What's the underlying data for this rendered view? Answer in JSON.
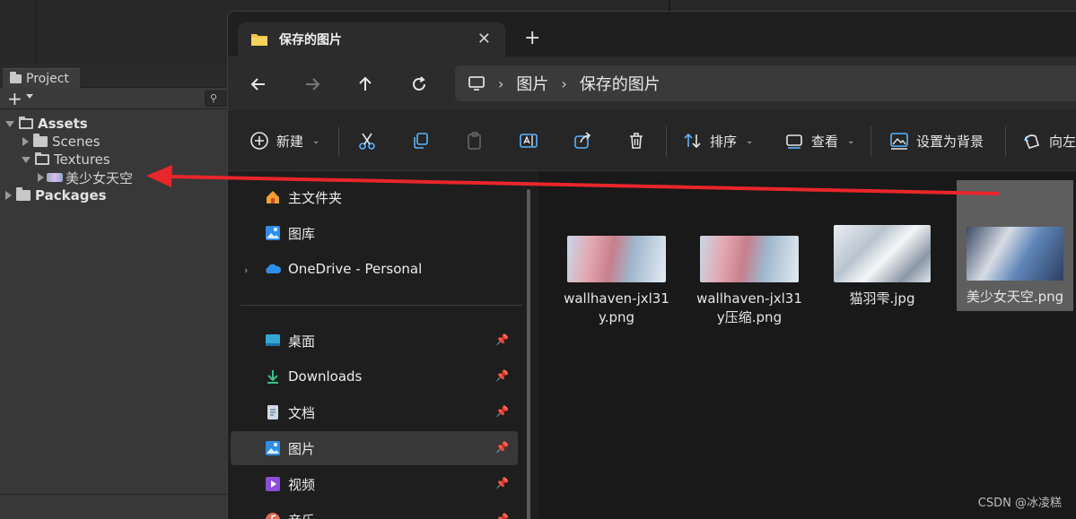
{
  "unity": {
    "panel_tab": "Project",
    "search_hint": "q",
    "tree": {
      "assets": "Assets",
      "scenes": "Scenes",
      "textures": "Textures",
      "image_asset": "美少女天空",
      "packages": "Packages"
    }
  },
  "explorer": {
    "tab_title": "保存的图片",
    "breadcrumb": [
      "图片",
      "保存的图片"
    ],
    "commands": {
      "new": "新建",
      "sort": "排序",
      "view": "查看",
      "set_background": "设置为背景",
      "rotate_left": "向左"
    },
    "nav": {
      "home": "主文件夹",
      "gallery": "图库",
      "onedrive": "OneDrive - Personal",
      "desktop": "桌面",
      "downloads": "Downloads",
      "documents": "文档",
      "pictures": "图片",
      "videos": "视频",
      "music": "音乐"
    },
    "files": [
      {
        "name_line1": "wallhaven-jxl31",
        "name_line2": "y.png"
      },
      {
        "name_line1": "wallhaven-jxl31",
        "name_line2": "y压缩.png"
      },
      {
        "name_line1": "猫羽雫.jpg",
        "name_line2": ""
      },
      {
        "name_line1": "美少女天空.png",
        "name_line2": ""
      }
    ]
  },
  "colors": {
    "arrow": "#e8262b",
    "folder_yellow": "#f0c040",
    "onedrive_blue": "#2f8ee8"
  },
  "watermark": "CSDN @冰凌糕"
}
